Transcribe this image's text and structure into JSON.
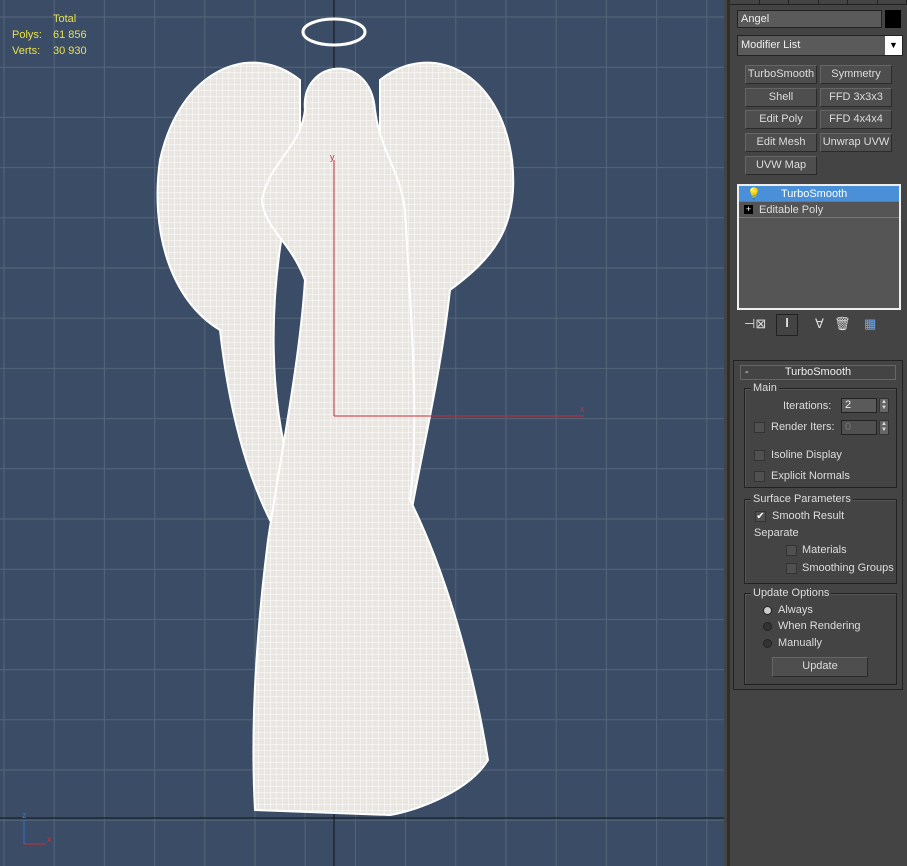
{
  "viewport": {
    "stats": {
      "header": "Total",
      "polys_label": "Polys:",
      "polys": "61 856",
      "verts_label": "Verts:",
      "verts": "30 930"
    },
    "axis": {
      "x": "x",
      "y": "y",
      "z": "z"
    },
    "colors": {
      "background": "#3b4d66",
      "mesh": "#f4f2ee",
      "grid": "#55657a",
      "x_axis": "#c8303a"
    }
  },
  "panel": {
    "object_name": "Angel",
    "object_color": "#000000",
    "modifier_list": "Modifier List",
    "buttons": [
      "TurboSmooth",
      "Symmetry",
      "Shell",
      "FFD 3x3x3",
      "Edit Poly",
      "FFD 4x4x4",
      "Edit Mesh",
      "Unwrap UVW",
      "UVW Map"
    ],
    "stack": [
      {
        "label": "TurboSmooth",
        "selected": true,
        "icon": "lightbulb-icon"
      },
      {
        "label": "Editable Poly",
        "selected": false,
        "icon": "plus-icon"
      }
    ],
    "stack_icons": [
      "pin-stack-icon",
      "show-end-result-icon",
      "make-unique-icon",
      "remove-modifier-icon",
      "configure-modifier-sets-icon"
    ]
  },
  "turbosmooth": {
    "title": "TurboSmooth",
    "collapse": "-",
    "main": {
      "label": "Main",
      "iterations_label": "Iterations:",
      "iterations": "2",
      "render_iters_label": "Render Iters:",
      "render_iters": "0",
      "render_iters_checked": false,
      "isoline_label": "Isoline Display",
      "isoline_checked": false,
      "explicit_label": "Explicit Normals",
      "explicit_checked": false
    },
    "surface": {
      "label": "Surface Parameters",
      "smooth_label": "Smooth Result",
      "smooth_checked": true,
      "separate_label": "Separate",
      "materials_label": "Materials",
      "materials_checked": false,
      "groups_label": "Smoothing Groups",
      "groups_checked": false
    },
    "update": {
      "label": "Update Options",
      "always": "Always",
      "when_rendering": "When Rendering",
      "manually": "Manually",
      "selected": "Always",
      "button": "Update"
    }
  }
}
